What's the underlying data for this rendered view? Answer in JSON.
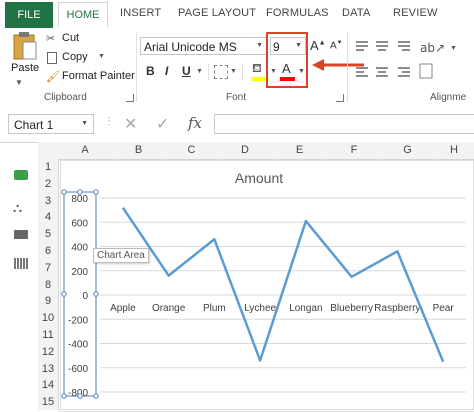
{
  "tabs": [
    "FILE",
    "HOME",
    "INSERT",
    "PAGE LAYOUT",
    "FORMULAS",
    "DATA",
    "REVIEW"
  ],
  "clipboard": {
    "paste": "Paste",
    "cut": "Cut",
    "copy": "Copy",
    "format_painter": "Format Painter",
    "group_label": "Clipboard"
  },
  "font": {
    "name": "Arial Unicode MS",
    "size": "9",
    "bold": "B",
    "italic": "I",
    "underline": "U",
    "group_label": "Font",
    "font_color": "#ff0000",
    "fill_color": "#ffff00"
  },
  "alignment": {
    "group_label": "Alignme"
  },
  "formula_bar": {
    "name_box": "Chart 1",
    "cancel": "✕",
    "enter": "✓",
    "fx": "fx",
    "value": ""
  },
  "columns": [
    "A",
    "B",
    "C",
    "D",
    "E",
    "F",
    "G",
    "H"
  ],
  "rows": [
    "1",
    "2",
    "3",
    "4",
    "5",
    "6",
    "7",
    "8",
    "9",
    "10",
    "11",
    "12",
    "13",
    "14",
    "15"
  ],
  "tooltip": "Chart Area",
  "chart_data": {
    "type": "line",
    "title": "Amount",
    "categories": [
      "Apple",
      "Orange",
      "Plum",
      "Lychee",
      "Longan",
      "Blueberry",
      "Raspberry",
      "Pear"
    ],
    "series": [
      {
        "values": [
          720,
          160,
          460,
          -540,
          610,
          150,
          360,
          -550
        ]
      }
    ],
    "ylim": [
      -800,
      800
    ],
    "yticks": [
      "800",
      "600",
      "400",
      "200",
      "0",
      "-200",
      "-400",
      "-600",
      "-800"
    ],
    "grid": true,
    "line_color": "#5b9bd5"
  }
}
